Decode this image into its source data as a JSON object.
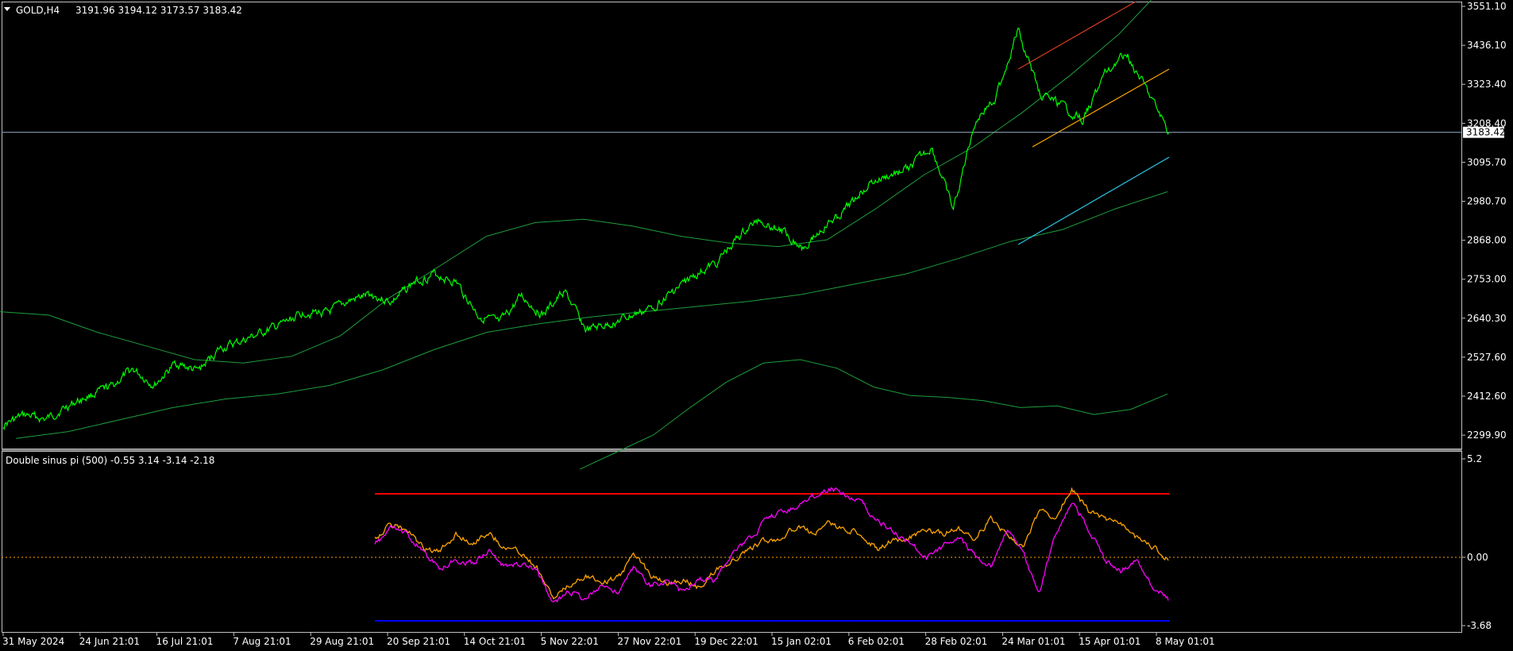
{
  "header": {
    "symbol_tf": "GOLD,H4",
    "ohlc": "3191.96 3194.12 3173.57 3183.42"
  },
  "price_axis": {
    "ticks": [
      "3551.10",
      "3436.10",
      "3323.40",
      "3208.40",
      "3095.70",
      "2980.70",
      "2868.00",
      "2753.00",
      "2640.30",
      "2527.60",
      "2412.60",
      "2299.90"
    ],
    "current": "3183.42"
  },
  "indicator": {
    "label": "Double sinus pi (500) -0.55 3.14 -3.14 -2.18",
    "ticks": [
      "5.2",
      "0.00",
      "-3.68"
    ]
  },
  "time_axis": {
    "ticks": [
      "31 May 2024",
      "24 Jun 21:01",
      "16 Jul 21:01",
      "7 Aug 21:01",
      "29 Aug 21:01",
      "20 Sep 21:01",
      "14 Oct 21:01",
      "5 Nov 22:01",
      "27 Nov 22:01",
      "19 Dec 22:01",
      "15 Jan 02:01",
      "6 Feb 02:01",
      "28 Feb 02:01",
      "24 Mar 01:01",
      "15 Apr 01:01",
      "8 May 01:01"
    ]
  },
  "colors": {
    "price": "#00ff00",
    "bands": "#1e9e3c",
    "current_line": "#8fa8c0",
    "trend_red": "#d43a1e",
    "trend_orange": "#ffa500",
    "trend_cyan": "#2ec6e6",
    "ind_magenta": "#ff00ff",
    "ind_orange": "#ffa500",
    "level_red": "#ff0000",
    "level_blue": "#0000ff",
    "zero_line": "#ffa500"
  },
  "chart_data": [
    {
      "type": "line",
      "title": "GOLD,H4",
      "y_range": [
        2270,
        3580
      ],
      "series": [
        {
          "values": [
            2330,
            2358,
            2345,
            2385,
            2415,
            2440,
            2492,
            2445,
            2510,
            2485,
            2550,
            2572,
            2598,
            2625,
            2660,
            2655,
            2690,
            2710,
            2688,
            2745,
            2770,
            2745,
            2650,
            2625,
            2705,
            2650,
            2720,
            2605,
            2622,
            2645,
            2670,
            2718,
            2765,
            2800,
            2875,
            2930,
            2900,
            2850,
            2905,
            2955,
            3030,
            3055,
            3080,
            3140,
            2955,
            3215,
            3290,
            3480,
            3300,
            3260,
            3220,
            3350,
            3420,
            3300,
            3183
          ]
        }
      ]
    },
    {
      "type": "line",
      "title": "Double sinus pi (500) -0.55 3.14 -3.14 -2.18",
      "y_range": [
        -3.68,
        5.2
      ],
      "levels": [
        3.14,
        0.0,
        -3.14
      ],
      "series": [
        {
          "values": [
            0.6,
            1.5,
            1.2,
            0.2,
            -0.7,
            -0.2,
            -0.4,
            0.3,
            -0.6,
            -0.4,
            -0.8,
            -2.6,
            -1.9,
            -2.3,
            -1.5,
            -2.0,
            -0.6,
            -1.6,
            -1.3,
            -2.0,
            -1.2,
            -1.3,
            0.2,
            0.8,
            1.8,
            2.4,
            2.7,
            3.2,
            3.7,
            3.4,
            2.9,
            1.9,
            1.3,
            0.8,
            -0.2,
            0.5,
            1.1,
            0.0,
            -0.6,
            1.5,
            0.1,
            -2.0,
            1.3,
            3.0,
            1.5,
            -0.2,
            -0.8,
            -0.2,
            -1.6,
            -2.4
          ]
        },
        {
          "values": [
            1.0,
            1.7,
            1.4,
            0.4,
            0.2,
            1.2,
            0.7,
            1.3,
            0.5,
            0.2,
            -0.6,
            -2.3,
            -1.6,
            -1.0,
            -1.4,
            -1.2,
            0.1,
            -1.0,
            -1.5,
            -1.3,
            -1.7,
            -0.8,
            -0.3,
            0.3,
            0.8,
            1.0,
            1.6,
            1.2,
            1.8,
            1.4,
            1.2,
            0.4,
            0.9,
            1.0,
            1.5,
            1.2,
            1.5,
            0.9,
            2.0,
            1.1,
            0.6,
            2.4,
            2.2,
            3.6,
            2.5,
            2.0,
            1.8,
            1.0,
            0.5,
            -0.2
          ]
        }
      ]
    }
  ]
}
